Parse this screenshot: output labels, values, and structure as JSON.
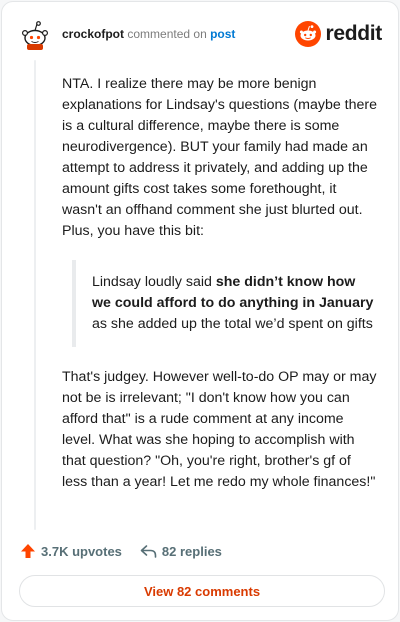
{
  "header": {
    "username": "crockofpot",
    "action_text": "commented on",
    "post_link": "post",
    "logo_text": "reddit"
  },
  "comment": {
    "paragraph1": "NTA. I realize there may be more benign explanations for Lindsay's questions (maybe there is a cultural difference, maybe there is some neurodivergence). BUT your family had made an attempt to address it privately, and adding up the amount gifts cost takes some forethought, it wasn't an offhand comment she just blurted out. Plus, you have this bit:",
    "quote_before": "Lindsay loudly said ",
    "quote_bold": "she didn’t know how we could afford to do anything in January",
    "quote_after": " as she added up the total we’d spent on gifts",
    "paragraph2": "That's judgey. However well-to-do OP may or may not be is irrelevant; \"I don't know how you can afford that\" is a rude comment at any income level. What was she hoping to accomplish with that question? \"Oh, you're right, brother's gf of less than a year! Let me redo my whole finances!\""
  },
  "footer": {
    "upvotes": "3.7K upvotes",
    "replies": "82 replies",
    "view_button": "View 82 comments"
  },
  "colors": {
    "reddit_orange": "#ff4500",
    "link_blue": "#0079d3",
    "button_text": "#d93a00",
    "muted_text": "#576f76"
  },
  "icons": {
    "avatar": "snoo-avatar-icon",
    "logo": "reddit-logo-icon",
    "upvote": "upvote-arrow-icon",
    "reply": "reply-arrow-icon"
  }
}
